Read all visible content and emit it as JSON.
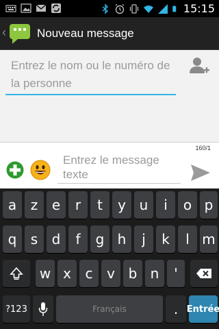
{
  "status_bar": {
    "time": "15:15"
  },
  "action_bar": {
    "title": "Nouveau message"
  },
  "recipient": {
    "placeholder": "Entrez le nom ou le numéro de la personne"
  },
  "compose": {
    "counter": "160/1",
    "placeholder": "Entrez le message texte"
  },
  "keyboard": {
    "row1": [
      "a",
      "z",
      "e",
      "r",
      "t",
      "y",
      "u",
      "i",
      "o",
      "p"
    ],
    "row2": [
      "q",
      "s",
      "d",
      "f",
      "g",
      "h",
      "j",
      "k",
      "l",
      "m"
    ],
    "row3": [
      "w",
      "x",
      "c",
      "v",
      "b",
      "n",
      "'"
    ],
    "symbols_label": "?123",
    "space_label": "Français",
    "period_label": ".",
    "enter_label": "Entrée"
  },
  "colors": {
    "accent": "#33b5e5",
    "enter": "#2f86b0",
    "add": "#2e9a2e"
  }
}
